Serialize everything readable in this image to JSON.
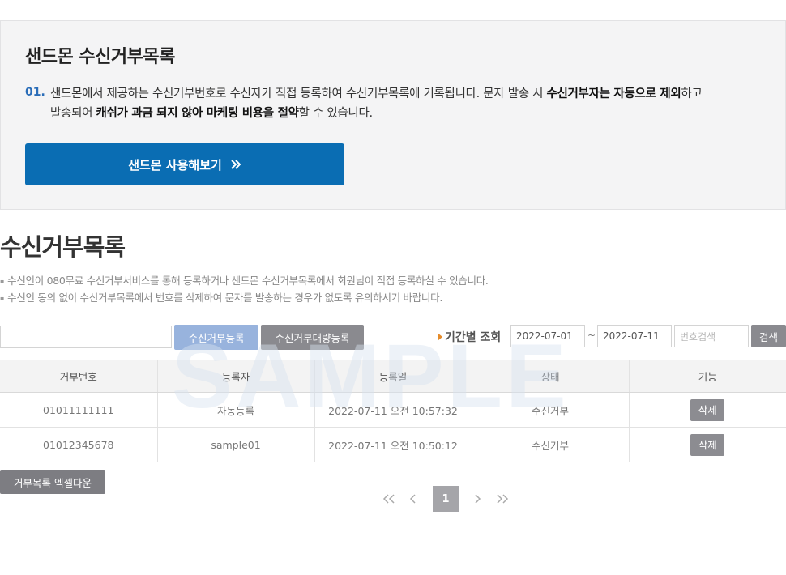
{
  "promo": {
    "title": "샌드몬 수신거부목록",
    "number": "01.",
    "text_parts": [
      {
        "text": "샌드몬에서 제공하는 수신거부번호로 수신자가 직접 등록하여 수신거부목록에 기록됩니다. 문자 발송 시 ",
        "bold": false
      },
      {
        "text": "수신거부자는 자동으로 제외",
        "bold": true
      },
      {
        "text": "하고 발송되어 ",
        "bold": false
      },
      {
        "text": "캐쉬가 과금 되지 않아 마케팅 비용을 절약",
        "bold": true
      },
      {
        "text": "할 수 있습니다.",
        "bold": false
      }
    ],
    "button_label": "샌드몬 사용해보기",
    "button_icon": "double-chevron-right-icon",
    "button_color": "#0a6db3"
  },
  "section": {
    "title": "수신거부목록",
    "notes": [
      "수신인이 080무료 수신거부서비스를 통해 등록하거나 샌드몬 수신거부목록에서 회원님이 직접 등록하실 수 있습니다.",
      "수신인 동의 없이 수신거부목록에서 번호를 삭제하여 문자를 발송하는 경우가 없도록 유의하시기 바랍니다."
    ]
  },
  "watermark": "SAMPLE",
  "toolbar": {
    "number_input_value": "",
    "register_label": "수신거부등록",
    "bulk_register_label": "수신거부대량등록",
    "period_label": "기간별 조회",
    "date_from": "2022-07-01",
    "date_separator": "~",
    "date_to": "2022-07-11",
    "search_placeholder": "번호검색",
    "search_label": "검색"
  },
  "table": {
    "headers": [
      "거부번호",
      "등록자",
      "등록일",
      "상태",
      "기능"
    ],
    "rows": [
      {
        "number": "01011111111",
        "registrant": "자동등록",
        "date": "2022-07-11 오전 10:57:32",
        "status": "수신거부",
        "action": "삭제"
      },
      {
        "number": "01012345678",
        "registrant": "sample01",
        "date": "2022-07-11 오전 10:50:12",
        "status": "수신거부",
        "action": "삭제"
      }
    ]
  },
  "excel_button_label": "거부목록 엑셀다운",
  "pagination": {
    "first": "«",
    "prev": "‹",
    "current": "1",
    "next": "›",
    "last": "»"
  },
  "colors": {
    "accent_blue": "#0a6db3",
    "light_blue_button": "#98b3dd",
    "gray_button": "#8a8a8f",
    "period_arrow": "#e58b2a"
  }
}
